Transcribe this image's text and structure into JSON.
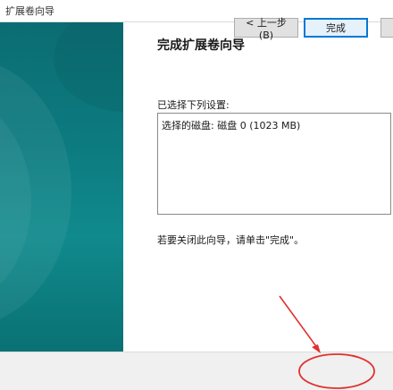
{
  "window": {
    "title": "扩展卷向导"
  },
  "wizard": {
    "heading": "完成扩展卷向导",
    "settings_label": "已选择下列设置:",
    "settings_lines": [
      "选择的磁盘: 磁盘 0 (1023 MB)"
    ],
    "close_hint": "若要关闭此向导，请单击\"完成\"。"
  },
  "buttons": {
    "back_label": "< 上一步(B)",
    "finish_label": "完成",
    "cancel_label": ""
  },
  "colors": {
    "side_panel": "#0c7a7f",
    "annotation": "#e0312f",
    "focus_border": "#0078d7"
  }
}
